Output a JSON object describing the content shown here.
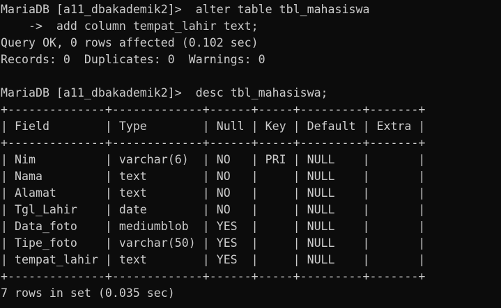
{
  "terminal": {
    "lines": [
      "MariaDB [a11_dbakademik2]>  alter table tbl_mahasiswa",
      "    ->  add column tempat_lahir text;",
      "Query OK, 0 rows affected (0.102 sec)",
      "Records: 0  Duplicates: 0  Warnings: 0",
      "",
      "MariaDB [a11_dbakademik2]>  desc tbl_mahasiswa;",
      "+--------------+-------------+------+-----+---------+-------+",
      "| Field        | Type        | Null | Key | Default | Extra |",
      "+--------------+-------------+------+-----+---------+-------+",
      "| Nim          | varchar(6)  | NO   | PRI | NULL    |       |",
      "| Nama         | text        | NO   |     | NULL    |       |",
      "| Alamat       | text        | NO   |     | NULL    |       |",
      "| Tgl_Lahir    | date        | NO   |     | NULL    |       |",
      "| Data_foto    | mediumblob  | YES  |     | NULL    |       |",
      "| Tipe_foto    | varchar(50) | YES  |     | NULL    |       |",
      "| tempat_lahir | text        | YES  |     | NULL    |       |",
      "+--------------+-------------+------+-----+---------+-------+",
      "7 rows in set (0.035 sec)"
    ]
  }
}
